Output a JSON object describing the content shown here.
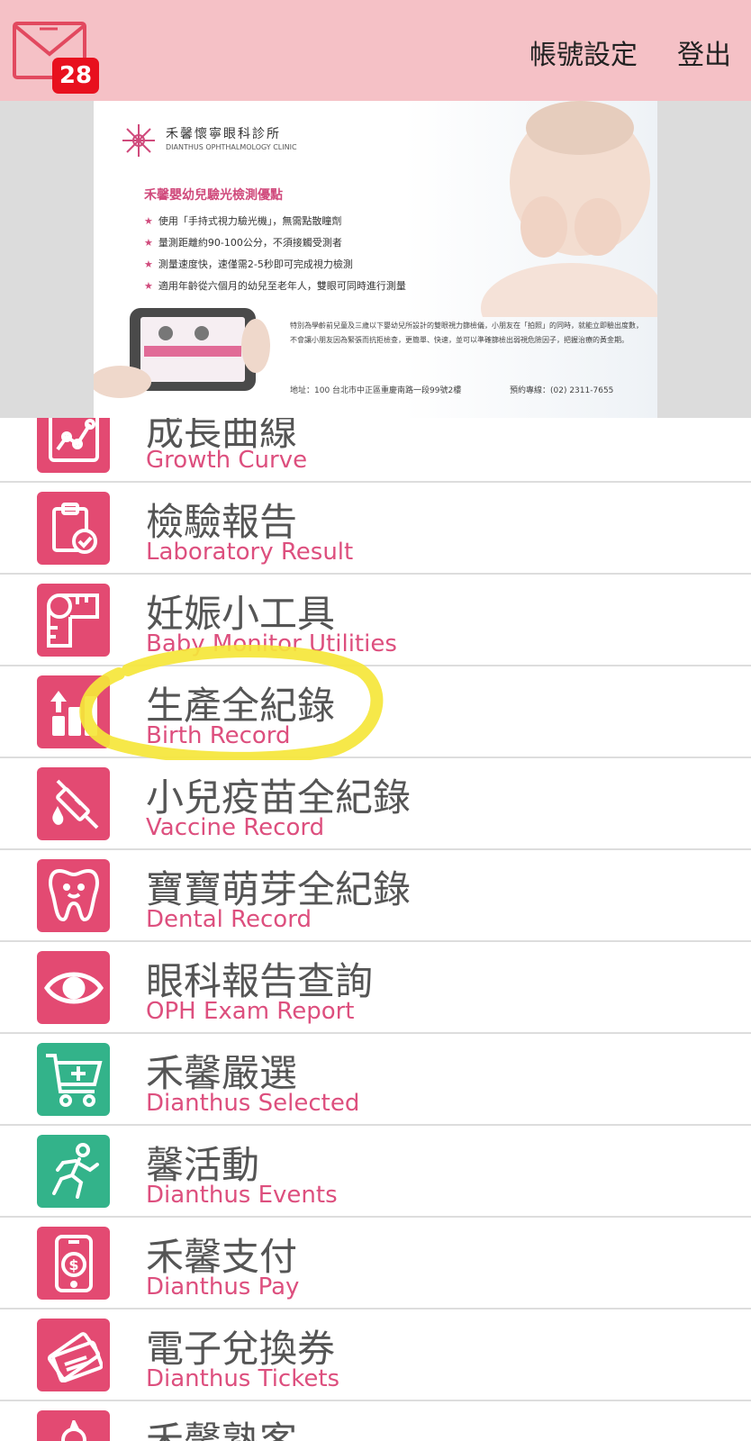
{
  "header": {
    "unread_count": "28",
    "account_settings_label": "帳號設定",
    "logout_label": "登出",
    "colors": {
      "bar": "#f5c1c6",
      "badge": "#e8101e"
    }
  },
  "banner": {
    "clinic_name_zh": "禾馨懷寧眼科診所",
    "clinic_name_en": "DIANTHUS OPHTHALMOLOGY CLINIC",
    "promo_title": "禾馨嬰幼兒驗光檢測優點",
    "promo_points": [
      "使用「手持式視力驗光機」，無需點散瞳劑",
      "量測距離約90-100公分，不須接觸受測者",
      "測量速度快，速僅需2-5秒即可完成視力檢測",
      "適用年齡從六個月的幼兒至老年人，雙眼可同時進行測量"
    ],
    "paragraph": "特別為學齡前兒童及三歲以下嬰幼兒所設計的雙眼視力篩檢儀，小朋友在「拍照」的同時，就能立即驗出度數，不會讓小朋友因為緊張而抗拒檢查，更簡單、快速，並可以準確篩檢出弱視危險因子，把握治療的黃金期。",
    "address": "地址：100 台北市中正區重慶南路一段99號2樓",
    "phone": "預約專線：(02) 2311-7655"
  },
  "menu": {
    "colors": {
      "pink": "#e34a72",
      "green": "#33b38a",
      "english_label": "#dd4f7e"
    },
    "items": [
      {
        "zh": "成長曲線",
        "en": "Growth Curve",
        "icon": "growth-chart-icon"
      },
      {
        "zh": "檢驗報告",
        "en": "Laboratory Result",
        "icon": "clipboard-check-icon"
      },
      {
        "zh": "妊娠小工具",
        "en": "Baby Monitor Utilities",
        "icon": "measuring-tape-icon"
      },
      {
        "zh": "生產全紀錄",
        "en": "Birth Record",
        "icon": "bar-chart-up-icon"
      },
      {
        "zh": "小兒疫苗全紀錄",
        "en": "Vaccine Record",
        "icon": "syringe-icon"
      },
      {
        "zh": "寶寶萌芽全紀錄",
        "en": "Dental Record",
        "icon": "tooth-icon"
      },
      {
        "zh": "眼科報告查詢",
        "en": "OPH Exam Report",
        "icon": "eye-icon"
      },
      {
        "zh": "禾馨嚴選",
        "en": "Dianthus Selected",
        "icon": "shopping-cart-plus-icon"
      },
      {
        "zh": "馨活動",
        "en": "Dianthus Events",
        "icon": "running-person-icon"
      },
      {
        "zh": "禾馨支付",
        "en": "Dianthus Pay",
        "icon": "mobile-dollar-icon"
      },
      {
        "zh": "電子兌換券",
        "en": "Dianthus Tickets",
        "icon": "tickets-icon"
      },
      {
        "zh": "禾馨熟客",
        "en": "",
        "icon": "vip-customer-icon"
      }
    ]
  }
}
